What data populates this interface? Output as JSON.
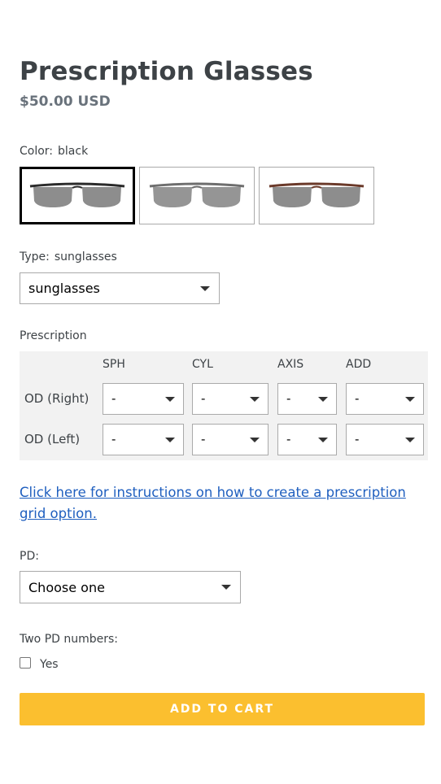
{
  "product": {
    "title": "Prescription Glasses",
    "price": "$50.00 USD"
  },
  "color": {
    "label": "Color:",
    "selected": "black",
    "swatches": [
      {
        "name": "black",
        "frame_color": "#2b2b2b",
        "selected": true
      },
      {
        "name": "gray",
        "frame_color": "#6e6e6e",
        "selected": false
      },
      {
        "name": "brown",
        "frame_color": "#6b3a2a",
        "selected": false
      }
    ]
  },
  "type": {
    "label": "Type:",
    "selected": "sunglasses",
    "select_value": "sunglasses"
  },
  "prescription": {
    "label": "Prescription",
    "columns": [
      "SPH",
      "CYL",
      "AXIS",
      "ADD"
    ],
    "rows": [
      {
        "label": "OD (Right)",
        "values": [
          "-",
          "-",
          "-",
          "-"
        ]
      },
      {
        "label": "OD (Left)",
        "values": [
          "-",
          "-",
          "-",
          "-"
        ]
      }
    ]
  },
  "instructions_link": "Click here for instructions on how to create a prescription grid option.",
  "pd": {
    "label": "PD:",
    "select_value": "Choose one"
  },
  "two_pd": {
    "label": "Two PD numbers:",
    "checkbox_label": "Yes",
    "checked": false
  },
  "cart": {
    "button_label": "ADD TO CART",
    "button_color": "#fbbf2f"
  },
  "colors": {
    "text": "#3d4246",
    "price": "#69727b",
    "link": "#1f5fbf",
    "grid_background": "#f2f2f2"
  }
}
